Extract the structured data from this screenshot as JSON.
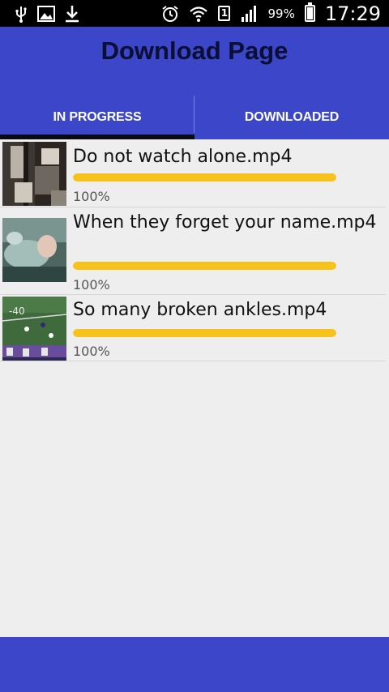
{
  "status_bar": {
    "battery_percent": "99%",
    "time": "17:29",
    "sim_label": "1",
    "icons": [
      "usb-icon",
      "image-icon",
      "download-icon",
      "alarm-icon",
      "wifi-icon",
      "sim-icon",
      "signal-icon",
      "battery-icon"
    ]
  },
  "app": {
    "title": "Download Page",
    "accent_color": "#3b46c9",
    "progress_color": "#f7c21b"
  },
  "tabs": [
    {
      "label": "IN PROGRESS",
      "active": true
    },
    {
      "label": "DOWNLOADED",
      "active": false
    }
  ],
  "downloads": [
    {
      "name": "Do not watch alone.mp4",
      "progress_percent": 100,
      "progress_label": "100%"
    },
    {
      "name": "When they forget your name.mp4",
      "progress_percent": 100,
      "progress_label": "100%"
    },
    {
      "name": "So many broken ankles.mp4",
      "progress_percent": 100,
      "progress_label": "100%"
    }
  ]
}
